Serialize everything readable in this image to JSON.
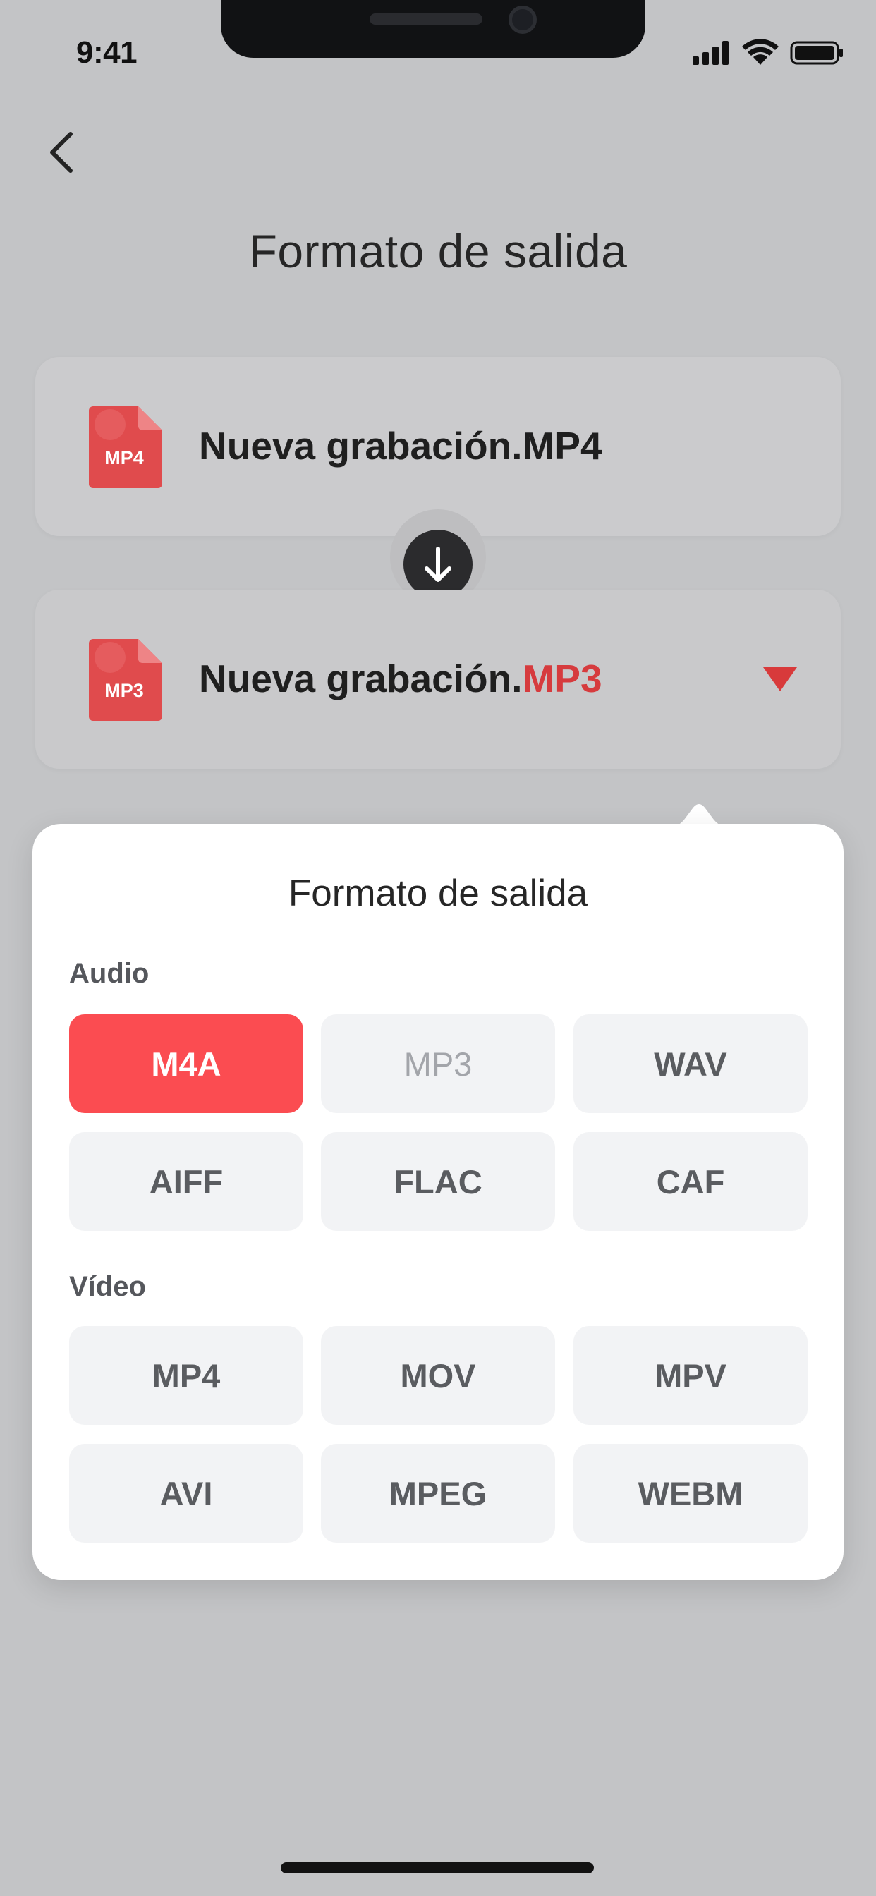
{
  "status_bar": {
    "time": "9:41"
  },
  "header": {
    "title": "Formato de salida",
    "back_icon": "chevron-left-icon"
  },
  "source_file": {
    "name": "Nueva grabación.MP4",
    "badge": "MP4"
  },
  "target_file": {
    "base": "Nueva grabación.",
    "ext": "MP3",
    "badge": "MP3"
  },
  "popover": {
    "title": "Formato de salida",
    "audio_label": "Audio",
    "audio": [
      "M4A",
      "MP3",
      "WAV",
      "AIFF",
      "FLAC",
      "CAF"
    ],
    "video_label": "Vídeo",
    "video": [
      "MP4",
      "MOV",
      "MPV",
      "AVI",
      "MPEG",
      "WEBM"
    ],
    "selected": "M4A",
    "disabled": "MP3"
  },
  "colors": {
    "accent": "#fb4c51",
    "accent_text": "#d63b3e",
    "file_icon": "#e04b4d",
    "chip_bg": "#f2f3f5",
    "dim_bg": "#c3c4c6"
  }
}
